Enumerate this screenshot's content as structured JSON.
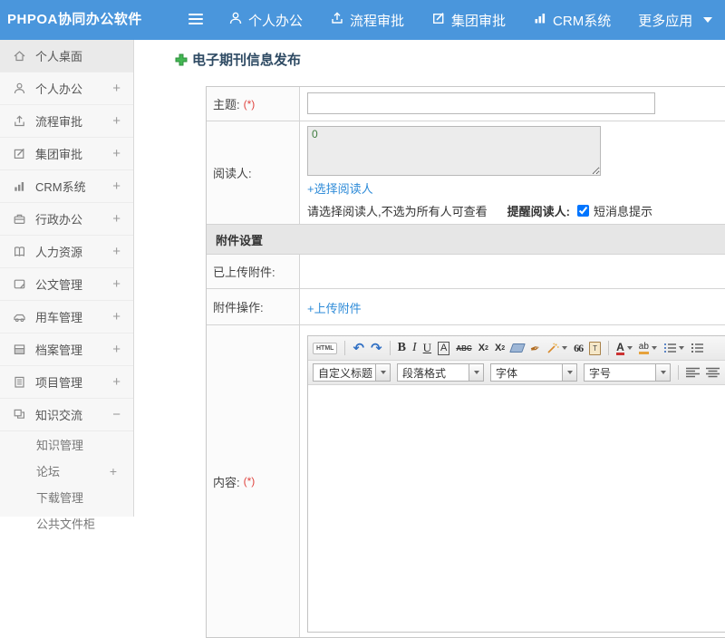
{
  "colors": {
    "topbar_blue": "#4a96dc",
    "link_blue": "#2e8bd8",
    "required_red": "#e0443f",
    "title_navy": "#2e4a63",
    "plus_green": "#43b753"
  },
  "topbar": {
    "logo": "PHPOA协同办公软件",
    "nav": [
      {
        "label": "个人办公",
        "icon": "person-icon"
      },
      {
        "label": "流程审批",
        "icon": "process-icon"
      },
      {
        "label": "集团审批",
        "icon": "edit-icon"
      },
      {
        "label": "CRM系统",
        "icon": "bar-chart-icon"
      },
      {
        "label": "更多应用",
        "icon": "caret-down-icon"
      }
    ]
  },
  "sidebar": {
    "items": [
      {
        "label": "个人桌面",
        "icon": "home-icon",
        "expand": "",
        "active": true
      },
      {
        "label": "个人办公",
        "icon": "person-icon",
        "expand": "+"
      },
      {
        "label": "流程审批",
        "icon": "process-icon",
        "expand": "+"
      },
      {
        "label": "集团审批",
        "icon": "edit-icon",
        "expand": "+"
      },
      {
        "label": "CRM系统",
        "icon": "bar-chart-icon",
        "expand": "+"
      },
      {
        "label": "行政办公",
        "icon": "briefcase-icon",
        "expand": "+"
      },
      {
        "label": "人力资源",
        "icon": "book-icon",
        "expand": "+"
      },
      {
        "label": "公文管理",
        "icon": "document-icon",
        "expand": "+"
      },
      {
        "label": "用车管理",
        "icon": "car-icon",
        "expand": "+"
      },
      {
        "label": "档案管理",
        "icon": "archive-icon",
        "expand": "+"
      },
      {
        "label": "项目管理",
        "icon": "notebook-icon",
        "expand": "+"
      },
      {
        "label": "知识交流",
        "icon": "chat-icon",
        "expand": "−"
      }
    ],
    "subitems": [
      {
        "label": "知识管理",
        "expand": ""
      },
      {
        "label": "论坛",
        "expand": "+"
      },
      {
        "label": "下载管理",
        "expand": ""
      },
      {
        "label": "公共文件柜",
        "expand": ""
      }
    ]
  },
  "page": {
    "title": "电子期刊信息发布"
  },
  "form": {
    "subject_label": "主题:",
    "required_mark": "(*)",
    "readers_label": "阅读人:",
    "readers_value": "0",
    "select_readers_link": "+选择阅读人",
    "readers_hint": "请选择阅读人,不选为所有人可查看",
    "remind_label": "提醒阅读人:",
    "sms_label": "短消息提示",
    "attachment_section": "附件设置",
    "uploaded_label": "已上传附件:",
    "attachment_action_label": "附件操作:",
    "upload_link": "+上传附件",
    "content_label": "内容:"
  },
  "editor": {
    "glyphs": {
      "html": "HTML",
      "undo": "↶",
      "redo": "↷",
      "bold": "B",
      "italic": "I",
      "underline": "U",
      "boxed_a": "A",
      "strike": "ABC",
      "sup_base": "X",
      "sup_mark": "2",
      "sub_base": "X",
      "sub_mark": "2",
      "brush": "✒",
      "quote": "66",
      "paste": "T",
      "font_color": "A",
      "bg_color": "ab"
    },
    "dropdowns": [
      "自定义标题",
      "段落格式",
      "字体",
      "字号"
    ],
    "toolbar_row1": [
      "html-source-button",
      "undo-icon",
      "redo-icon",
      "bold-icon",
      "italic-icon",
      "underline-icon",
      "font-box-icon",
      "strikethrough-icon",
      "superscript-icon",
      "subscript-icon",
      "eraser-icon",
      "format-brush-icon",
      "autoformat-wand-icon",
      "blockquote-icon",
      "paste-text-icon",
      "font-color-icon",
      "highlight-color-icon",
      "ordered-list-icon",
      "unordered-list-icon"
    ],
    "toolbar_row2": [
      "heading-select",
      "paragraph-select",
      "font-family-select",
      "font-size-select",
      "align-left-icon",
      "align-center-icon",
      "align-right-icon",
      "align-justify-icon",
      "link-icon",
      "unlink-icon",
      "image-icon",
      "map-image-icon"
    ]
  }
}
